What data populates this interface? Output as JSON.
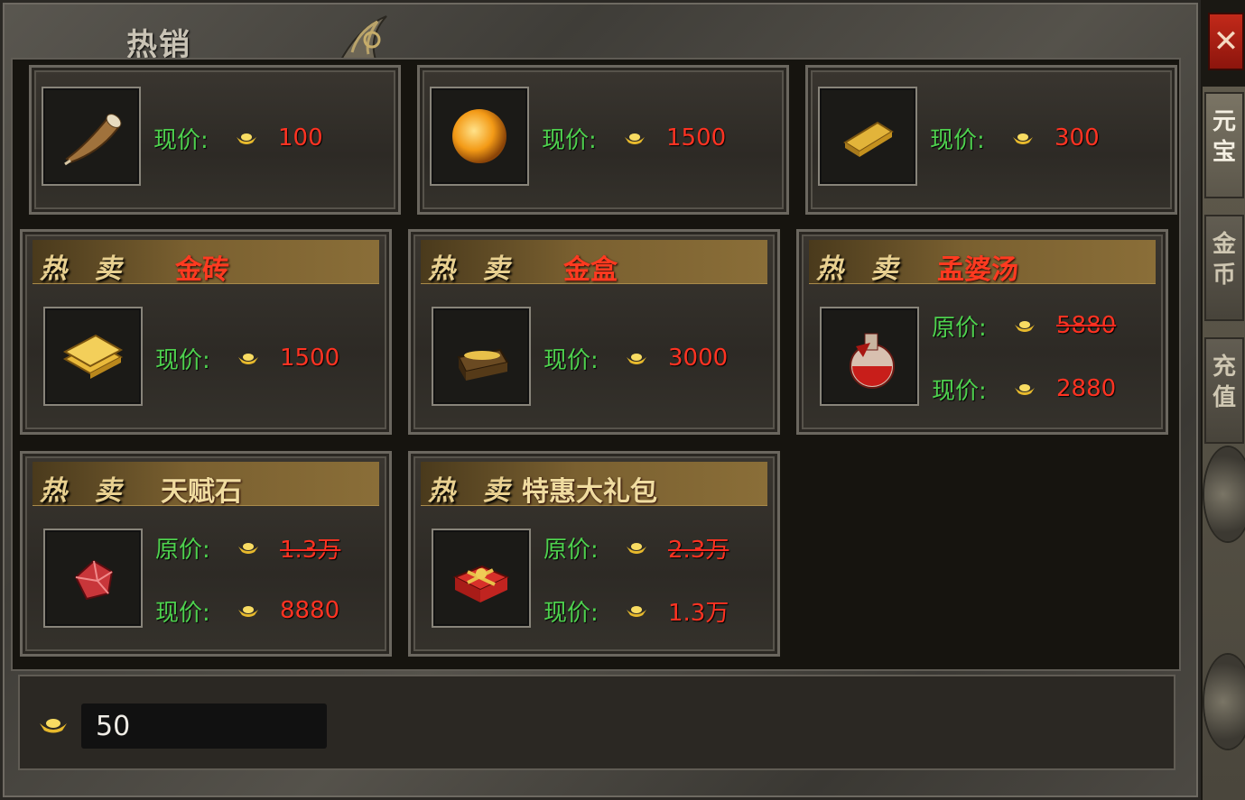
{
  "window": {
    "title": "热销",
    "close_label": "✕"
  },
  "side_tabs": [
    {
      "label": "元\n宝",
      "active": true
    },
    {
      "label": "金\n币",
      "active": false
    },
    {
      "label": "充\n值",
      "active": false
    }
  ],
  "hot_label": "热 卖",
  "price_labels": {
    "current": "现价:",
    "original": "原价:"
  },
  "items": [
    {
      "name": "",
      "icon": "horn-icon",
      "current": "100",
      "original": null
    },
    {
      "name": "",
      "icon": "amber-orb-icon",
      "current": "1500",
      "original": null
    },
    {
      "name": "",
      "icon": "gold-bar-icon",
      "current": "300",
      "original": null
    },
    {
      "name": "金砖",
      "icon": "gold-bricks-icon",
      "current": "1500",
      "original": null
    },
    {
      "name": "金盒",
      "icon": "treasure-chest-icon",
      "current": "3000",
      "original": null
    },
    {
      "name": "孟婆汤",
      "icon": "potion-flask-icon",
      "current": "2880",
      "original": "5880"
    },
    {
      "name": "天赋石",
      "icon": "red-gem-icon",
      "current": "8880",
      "original": "1.3万"
    },
    {
      "name": "特惠大礼包",
      "icon": "gift-box-icon",
      "current": "1.3万",
      "original": "2.3万"
    }
  ],
  "balance": {
    "currency_icon": "gold-ingot-icon",
    "value": "50"
  },
  "colors": {
    "current_label": "#4ed14e",
    "price": "#ff3322",
    "banner_name": "#ff3a20",
    "banner_name_alt": "#f0dca0"
  }
}
